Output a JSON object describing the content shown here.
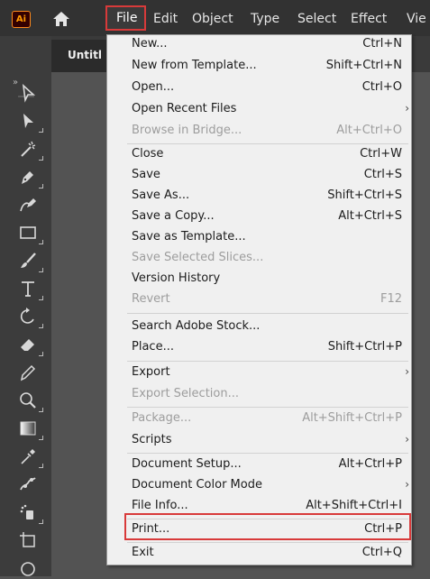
{
  "menubar": {
    "logo": "Ai",
    "items": [
      "File",
      "Edit",
      "Object",
      "Type",
      "Select",
      "Effect",
      "Vie"
    ]
  },
  "document": {
    "tab_label": "Untitl"
  },
  "toolbar": {
    "expand": "»",
    "tools": [
      "selection-tool",
      "direct-selection-tool",
      "magic-wand-tool",
      "pen-tool",
      "curvature-tool",
      "rectangle-tool",
      "paintbrush-tool",
      "type-tool",
      "rotate-tool",
      "eraser-tool",
      "pencil-tool",
      "zoom-tool",
      "gradient-tool",
      "eyedropper-tool",
      "puppet-warp-tool",
      "symbol-sprayer-tool",
      "artboard-tool",
      "ellipse-tool"
    ]
  },
  "file_menu": {
    "items": [
      {
        "label": "New...",
        "shortcut": "Ctrl+N",
        "disabled": false,
        "submenu": false
      },
      {
        "label": "New from Template...",
        "shortcut": "Shift+Ctrl+N",
        "disabled": false,
        "submenu": false
      },
      {
        "label": "Open...",
        "shortcut": "Ctrl+O",
        "disabled": false,
        "submenu": false
      },
      {
        "label": "Open Recent Files",
        "shortcut": "",
        "disabled": false,
        "submenu": true
      },
      {
        "label": "Browse in Bridge...",
        "shortcut": "Alt+Ctrl+O",
        "disabled": true,
        "submenu": false
      },
      {
        "label": "Close",
        "shortcut": "Ctrl+W",
        "disabled": false,
        "submenu": false
      },
      {
        "label": "Save",
        "shortcut": "Ctrl+S",
        "disabled": false,
        "submenu": false
      },
      {
        "label": "Save As...",
        "shortcut": "Shift+Ctrl+S",
        "disabled": false,
        "submenu": false
      },
      {
        "label": "Save a Copy...",
        "shortcut": "Alt+Ctrl+S",
        "disabled": false,
        "submenu": false
      },
      {
        "label": "Save as Template...",
        "shortcut": "",
        "disabled": false,
        "submenu": false
      },
      {
        "label": "Save Selected Slices...",
        "shortcut": "",
        "disabled": true,
        "submenu": false
      },
      {
        "label": "Version History",
        "shortcut": "",
        "disabled": false,
        "submenu": false
      },
      {
        "label": "Revert",
        "shortcut": "F12",
        "disabled": true,
        "submenu": false
      },
      {
        "label": "Search Adobe Stock...",
        "shortcut": "",
        "disabled": false,
        "submenu": false
      },
      {
        "label": "Place...",
        "shortcut": "Shift+Ctrl+P",
        "disabled": false,
        "submenu": false
      },
      {
        "label": "Export",
        "shortcut": "",
        "disabled": false,
        "submenu": true
      },
      {
        "label": "Export Selection...",
        "shortcut": "",
        "disabled": true,
        "submenu": false
      },
      {
        "label": "Package...",
        "shortcut": "Alt+Shift+Ctrl+P",
        "disabled": true,
        "submenu": false
      },
      {
        "label": "Scripts",
        "shortcut": "",
        "disabled": false,
        "submenu": true
      },
      {
        "label": "Document Setup...",
        "shortcut": "Alt+Ctrl+P",
        "disabled": false,
        "submenu": false
      },
      {
        "label": "Document Color Mode",
        "shortcut": "",
        "disabled": false,
        "submenu": true
      },
      {
        "label": "File Info...",
        "shortcut": "Alt+Shift+Ctrl+I",
        "disabled": false,
        "submenu": false
      },
      {
        "label": "Print...",
        "shortcut": "Ctrl+P",
        "disabled": false,
        "submenu": false
      },
      {
        "label": "Exit",
        "shortcut": "Ctrl+Q",
        "disabled": false,
        "submenu": false
      }
    ],
    "submenu_arrow": "›"
  },
  "colors": {
    "highlight": "#d83a3a",
    "menu_bg": "#f0f0f0",
    "logo_orange": "#ff9a00"
  }
}
